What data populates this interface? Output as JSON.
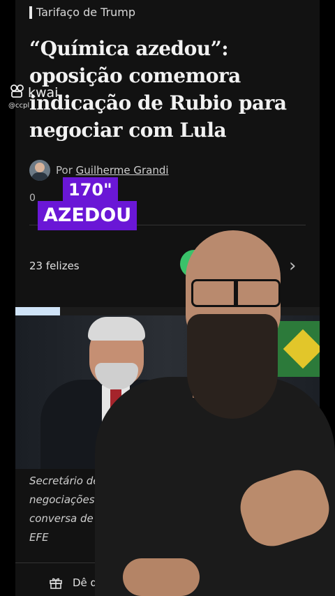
{
  "article": {
    "section_tag": "Tarifaço de Trump",
    "headline_lines": [
      "“Química azedou”:",
      "oposição comemora",
      "indicação de Rubio para",
      "negociar com Lula"
    ],
    "author_prefix": "Por",
    "author_name": "Guilherme Grandi",
    "date_partial": "0",
    "reactions_label": "23 felizes",
    "caption_lines": [
      "Secretário de",
      "negociações",
      "conversa de",
      "EFE"
    ],
    "gift_label": "Dê de p"
  },
  "watermark": {
    "brand": "kwai",
    "user": "@ccpl"
  },
  "overlay": {
    "line1": "170\"",
    "line2": "AZEDOU"
  },
  "icons": {
    "reaction": "happy-reaction-icon",
    "chevron": "chevron-right-icon",
    "gift": "gift-icon",
    "kwai": "kwai-logo-icon"
  },
  "colors": {
    "overlay_bg": "#6a17d6",
    "panel_bg": "#121212",
    "reaction": "#3ac26a"
  }
}
